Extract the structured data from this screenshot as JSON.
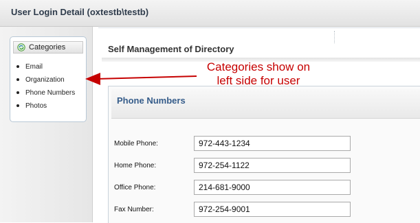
{
  "window": {
    "title": "User Login Detail (oxtestb\\testb)"
  },
  "sidebar": {
    "header": "Categories",
    "items": [
      {
        "label": "Email"
      },
      {
        "label": "Organization"
      },
      {
        "label": "Phone Numbers"
      },
      {
        "label": "Photos"
      }
    ]
  },
  "main": {
    "section_title": "Self Management of Directory",
    "panel_title": "Phone Numbers",
    "fields": [
      {
        "label": "Mobile Phone:",
        "value": "972-443-1234"
      },
      {
        "label": "Home Phone:",
        "value": "972-254-1122"
      },
      {
        "label": "Office Phone:",
        "value": "214-681-9000"
      },
      {
        "label": "Fax Number:",
        "value": "972-254-9001"
      }
    ]
  },
  "annotation": {
    "line1": "Categories show on",
    "line2": "left side for user",
    "color": "#c60000"
  }
}
